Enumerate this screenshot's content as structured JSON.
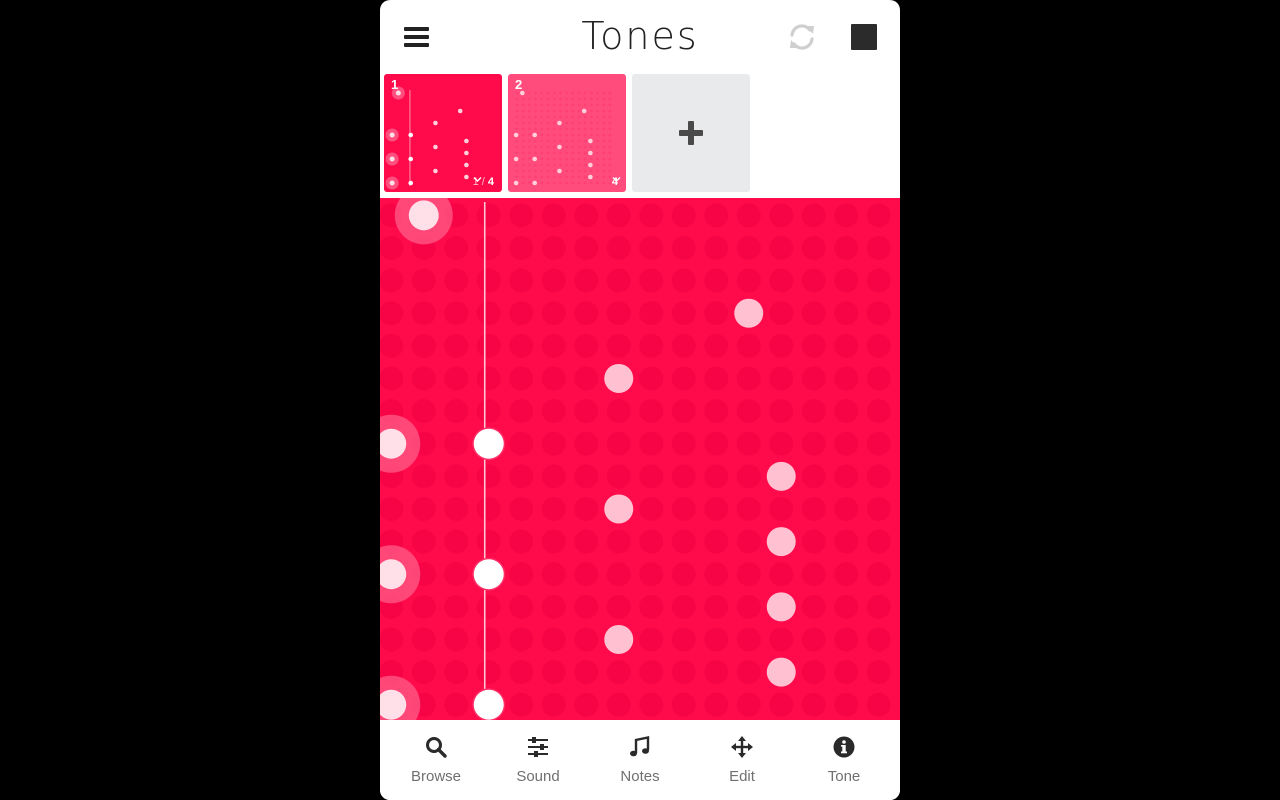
{
  "app": {
    "title": "Tones"
  },
  "colors": {
    "primary": "#ff0a4a",
    "secondary": "#ff4c7c",
    "add_tile": "#e9eaec",
    "nav_label": "#707070"
  },
  "header": {
    "menu_icon": "hamburger-menu-icon",
    "refresh_icon": "refresh-icon",
    "stop_icon": "stop-icon"
  },
  "patterns": [
    {
      "number": "1",
      "current": "1",
      "separator": "/",
      "total": "4",
      "active": true
    },
    {
      "number": "2",
      "total": "4",
      "active": false
    }
  ],
  "add_pattern": {
    "icon": "plus-icon"
  },
  "sequencer": {
    "columns": 16,
    "rows": 16,
    "playhead_column": 3,
    "notes": [
      {
        "col": 1,
        "row": 0
      },
      {
        "col": 0,
        "row": 7
      },
      {
        "col": 0,
        "row": 11
      },
      {
        "col": 0,
        "row": 15
      },
      {
        "col": 3,
        "row": 7
      },
      {
        "col": 3,
        "row": 11
      },
      {
        "col": 3,
        "row": 15
      },
      {
        "col": 7,
        "row": 5
      },
      {
        "col": 7,
        "row": 9
      },
      {
        "col": 7,
        "row": 13
      },
      {
        "col": 11,
        "row": 3
      },
      {
        "col": 12,
        "row": 8
      },
      {
        "col": 12,
        "row": 10
      },
      {
        "col": 12,
        "row": 12
      },
      {
        "col": 12,
        "row": 14
      }
    ]
  },
  "nav": [
    {
      "label": "Browse",
      "icon": "search-icon"
    },
    {
      "label": "Sound",
      "icon": "sliders-icon"
    },
    {
      "label": "Notes",
      "icon": "music-note-icon"
    },
    {
      "label": "Edit",
      "icon": "move-arrows-icon"
    },
    {
      "label": "Tone",
      "icon": "info-icon"
    }
  ]
}
